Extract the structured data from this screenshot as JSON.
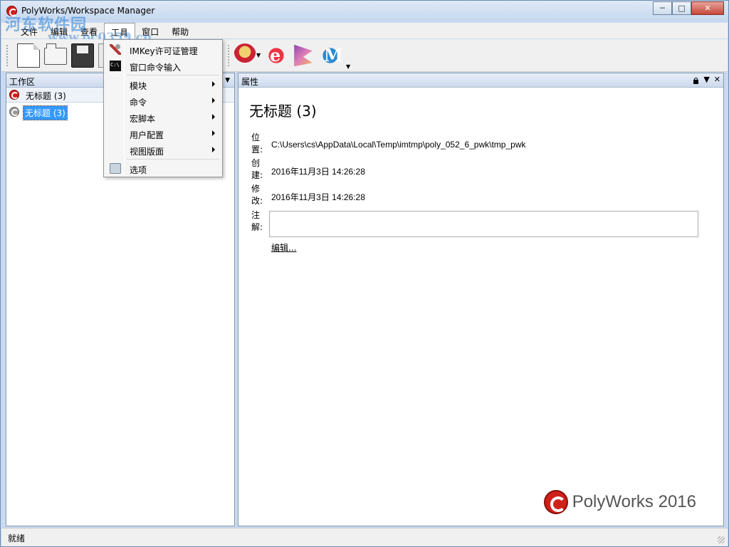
{
  "window": {
    "title": "PolyWorks/Workspace Manager"
  },
  "watermark": {
    "text": "河东软件园",
    "url": "www.pc0359.cn"
  },
  "menubar": {
    "items": [
      {
        "label": "文件"
      },
      {
        "label": "编辑"
      },
      {
        "label": "查看"
      },
      {
        "label": "工具"
      },
      {
        "label": "窗口"
      },
      {
        "label": "帮助"
      }
    ]
  },
  "tools_menu": {
    "items": [
      {
        "label": "IMKey许可证管理"
      },
      {
        "label": "窗口命令输入"
      },
      {
        "label": "模块"
      },
      {
        "label": "命令"
      },
      {
        "label": "宏脚本"
      },
      {
        "label": "用户配置"
      },
      {
        "label": "视图版面"
      },
      {
        "label": "选项"
      }
    ]
  },
  "workspace_panel": {
    "title": "工作区",
    "workspace": "无标题 (3)",
    "tree_item": "无标题 (3)"
  },
  "properties_panel": {
    "title": "属性",
    "heading": "无标题  (3)",
    "location_label": "位置:",
    "location_value": "C:\\Users\\cs\\AppData\\Local\\Temp\\imtmp\\poly_052_6_pwk\\tmp_pwk",
    "created_label": "创建:",
    "created_value": "2016年11月3日  14:26:28",
    "modified_label": "修改:",
    "modified_value": "2016年11月3日  14:26:28",
    "notes_label": "注解:",
    "notes_value": "",
    "edit_link": "编辑..."
  },
  "brand": {
    "text": "PolyWorks 2016"
  },
  "statusbar": {
    "text": "就绪"
  },
  "colors": {
    "accent": "#3399ff",
    "brand_red": "#d0201a"
  }
}
